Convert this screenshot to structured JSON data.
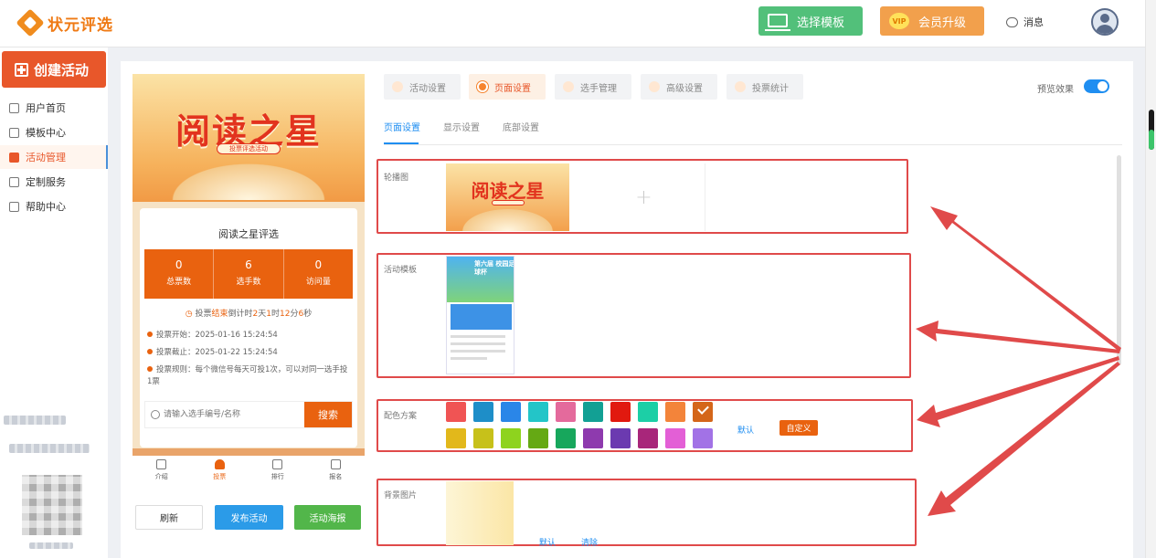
{
  "header": {
    "logo_text": "状元评选",
    "template_button": "选择模板",
    "vip_badge": "VIP",
    "vip_button": "会员升级",
    "messages": "消息"
  },
  "sidebar": {
    "create_button": "创建活动",
    "items": [
      {
        "label": "用户首页",
        "icon": "home-icon"
      },
      {
        "label": "模板中心",
        "icon": "folder-icon"
      },
      {
        "label": "活动管理",
        "icon": "activity-icon",
        "active": true
      },
      {
        "label": "定制服务",
        "icon": "custom-service-icon"
      },
      {
        "label": "帮助中心",
        "icon": "help-book-icon"
      }
    ]
  },
  "preview": {
    "banner_title": "阅读之星",
    "banner_subtitle": "投票评选活动",
    "card_title": "阅读之星评选",
    "stats": [
      {
        "value": "0",
        "label": "总票数"
      },
      {
        "value": "6",
        "label": "选手数"
      },
      {
        "value": "0",
        "label": "访问量"
      }
    ],
    "countdown": {
      "prefix": "投票",
      "status": "结束",
      "mid": "倒计时",
      "days": "2",
      "days_unit": "天",
      "hours": "1",
      "hours_unit": "时",
      "minutes": "12",
      "minutes_unit": "分",
      "seconds": "6",
      "seconds_unit": "秒"
    },
    "info": {
      "start": "投票开始：2025-01-16 15:24:54",
      "end": "投票截止：2025-01-22 15:24:54",
      "rule": "投票规则：每个微信号每天可投1次，可以对同一选手投1票"
    },
    "search_placeholder": "请输入选手编号/名称",
    "search_button": "搜索",
    "tabbar": [
      {
        "label": "介绍"
      },
      {
        "label": "投票",
        "active": true
      },
      {
        "label": "排行"
      },
      {
        "label": "报名"
      }
    ],
    "buttons": {
      "refresh": "刷新",
      "publish": "发布活动",
      "poster": "活动海报"
    }
  },
  "tabs": [
    {
      "label": "活动设置"
    },
    {
      "label": "页面设置",
      "active": true
    },
    {
      "label": "选手管理"
    },
    {
      "label": "高级设置"
    },
    {
      "label": "投票统计"
    }
  ],
  "preview_toggle_label": "预览效果",
  "preview_toggle_on": true,
  "subtabs": [
    {
      "label": "页面设置",
      "active": true
    },
    {
      "label": "显示设置"
    },
    {
      "label": "底部设置"
    }
  ],
  "sections": {
    "carousel": {
      "label": "轮播图",
      "image_title": "阅读之星",
      "add": "+"
    },
    "template": {
      "label": "活动模板",
      "thumb_title": "第六届 校园足球杯"
    },
    "color_scheme": {
      "label": "配色方案",
      "colors_row1": [
        "#f05454",
        "#1e8ec8",
        "#2a86e8",
        "#23c5c8",
        "#e46a9c",
        "#12a094",
        "#e1190f",
        "#1ccfa6",
        "#f3843a",
        "#d4661a"
      ],
      "colors_row2": [
        "#e2b81b",
        "#c7c11a",
        "#8ed31e",
        "#65a914",
        "#17a75c",
        "#8e3aae",
        "#6b3ab0",
        "#a8267a",
        "#e35fd6",
        "#a272e6"
      ],
      "selected": "#d4661a",
      "default_link": "默认",
      "custom_button": "自定义"
    },
    "background": {
      "label": "背景图片",
      "default_link": "默认",
      "clear_link": "清除"
    }
  }
}
